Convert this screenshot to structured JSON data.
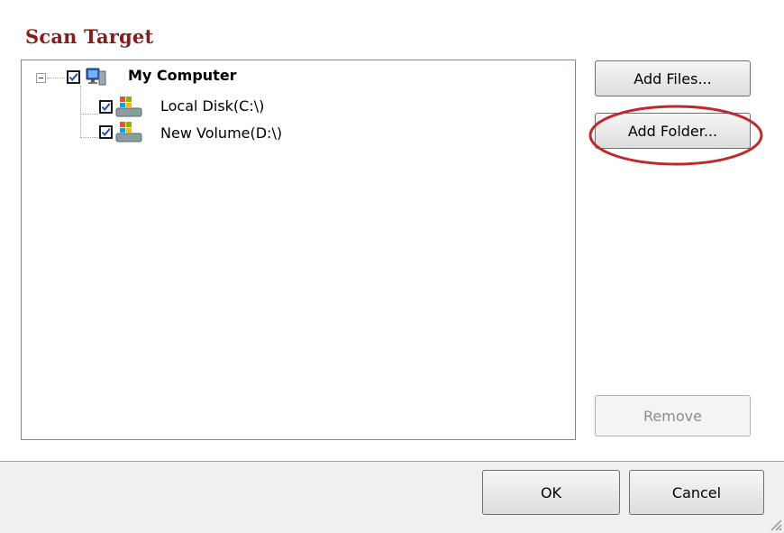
{
  "section": {
    "title": "Scan Target"
  },
  "tree": {
    "root": {
      "label": "My Computer",
      "checked": true,
      "icon": "computer-icon"
    },
    "children": [
      {
        "label": "Local Disk(C:\\)",
        "checked": true,
        "icon": "drive-icon"
      },
      {
        "label": "New Volume(D:\\)",
        "checked": true,
        "icon": "drive-icon"
      }
    ]
  },
  "buttons": {
    "add_files": "Add Files...",
    "add_folder": "Add Folder...",
    "remove": "Remove",
    "ok": "OK",
    "cancel": "Cancel"
  },
  "colors": {
    "title": "#8b1a1a",
    "highlight": "#c0282d"
  }
}
